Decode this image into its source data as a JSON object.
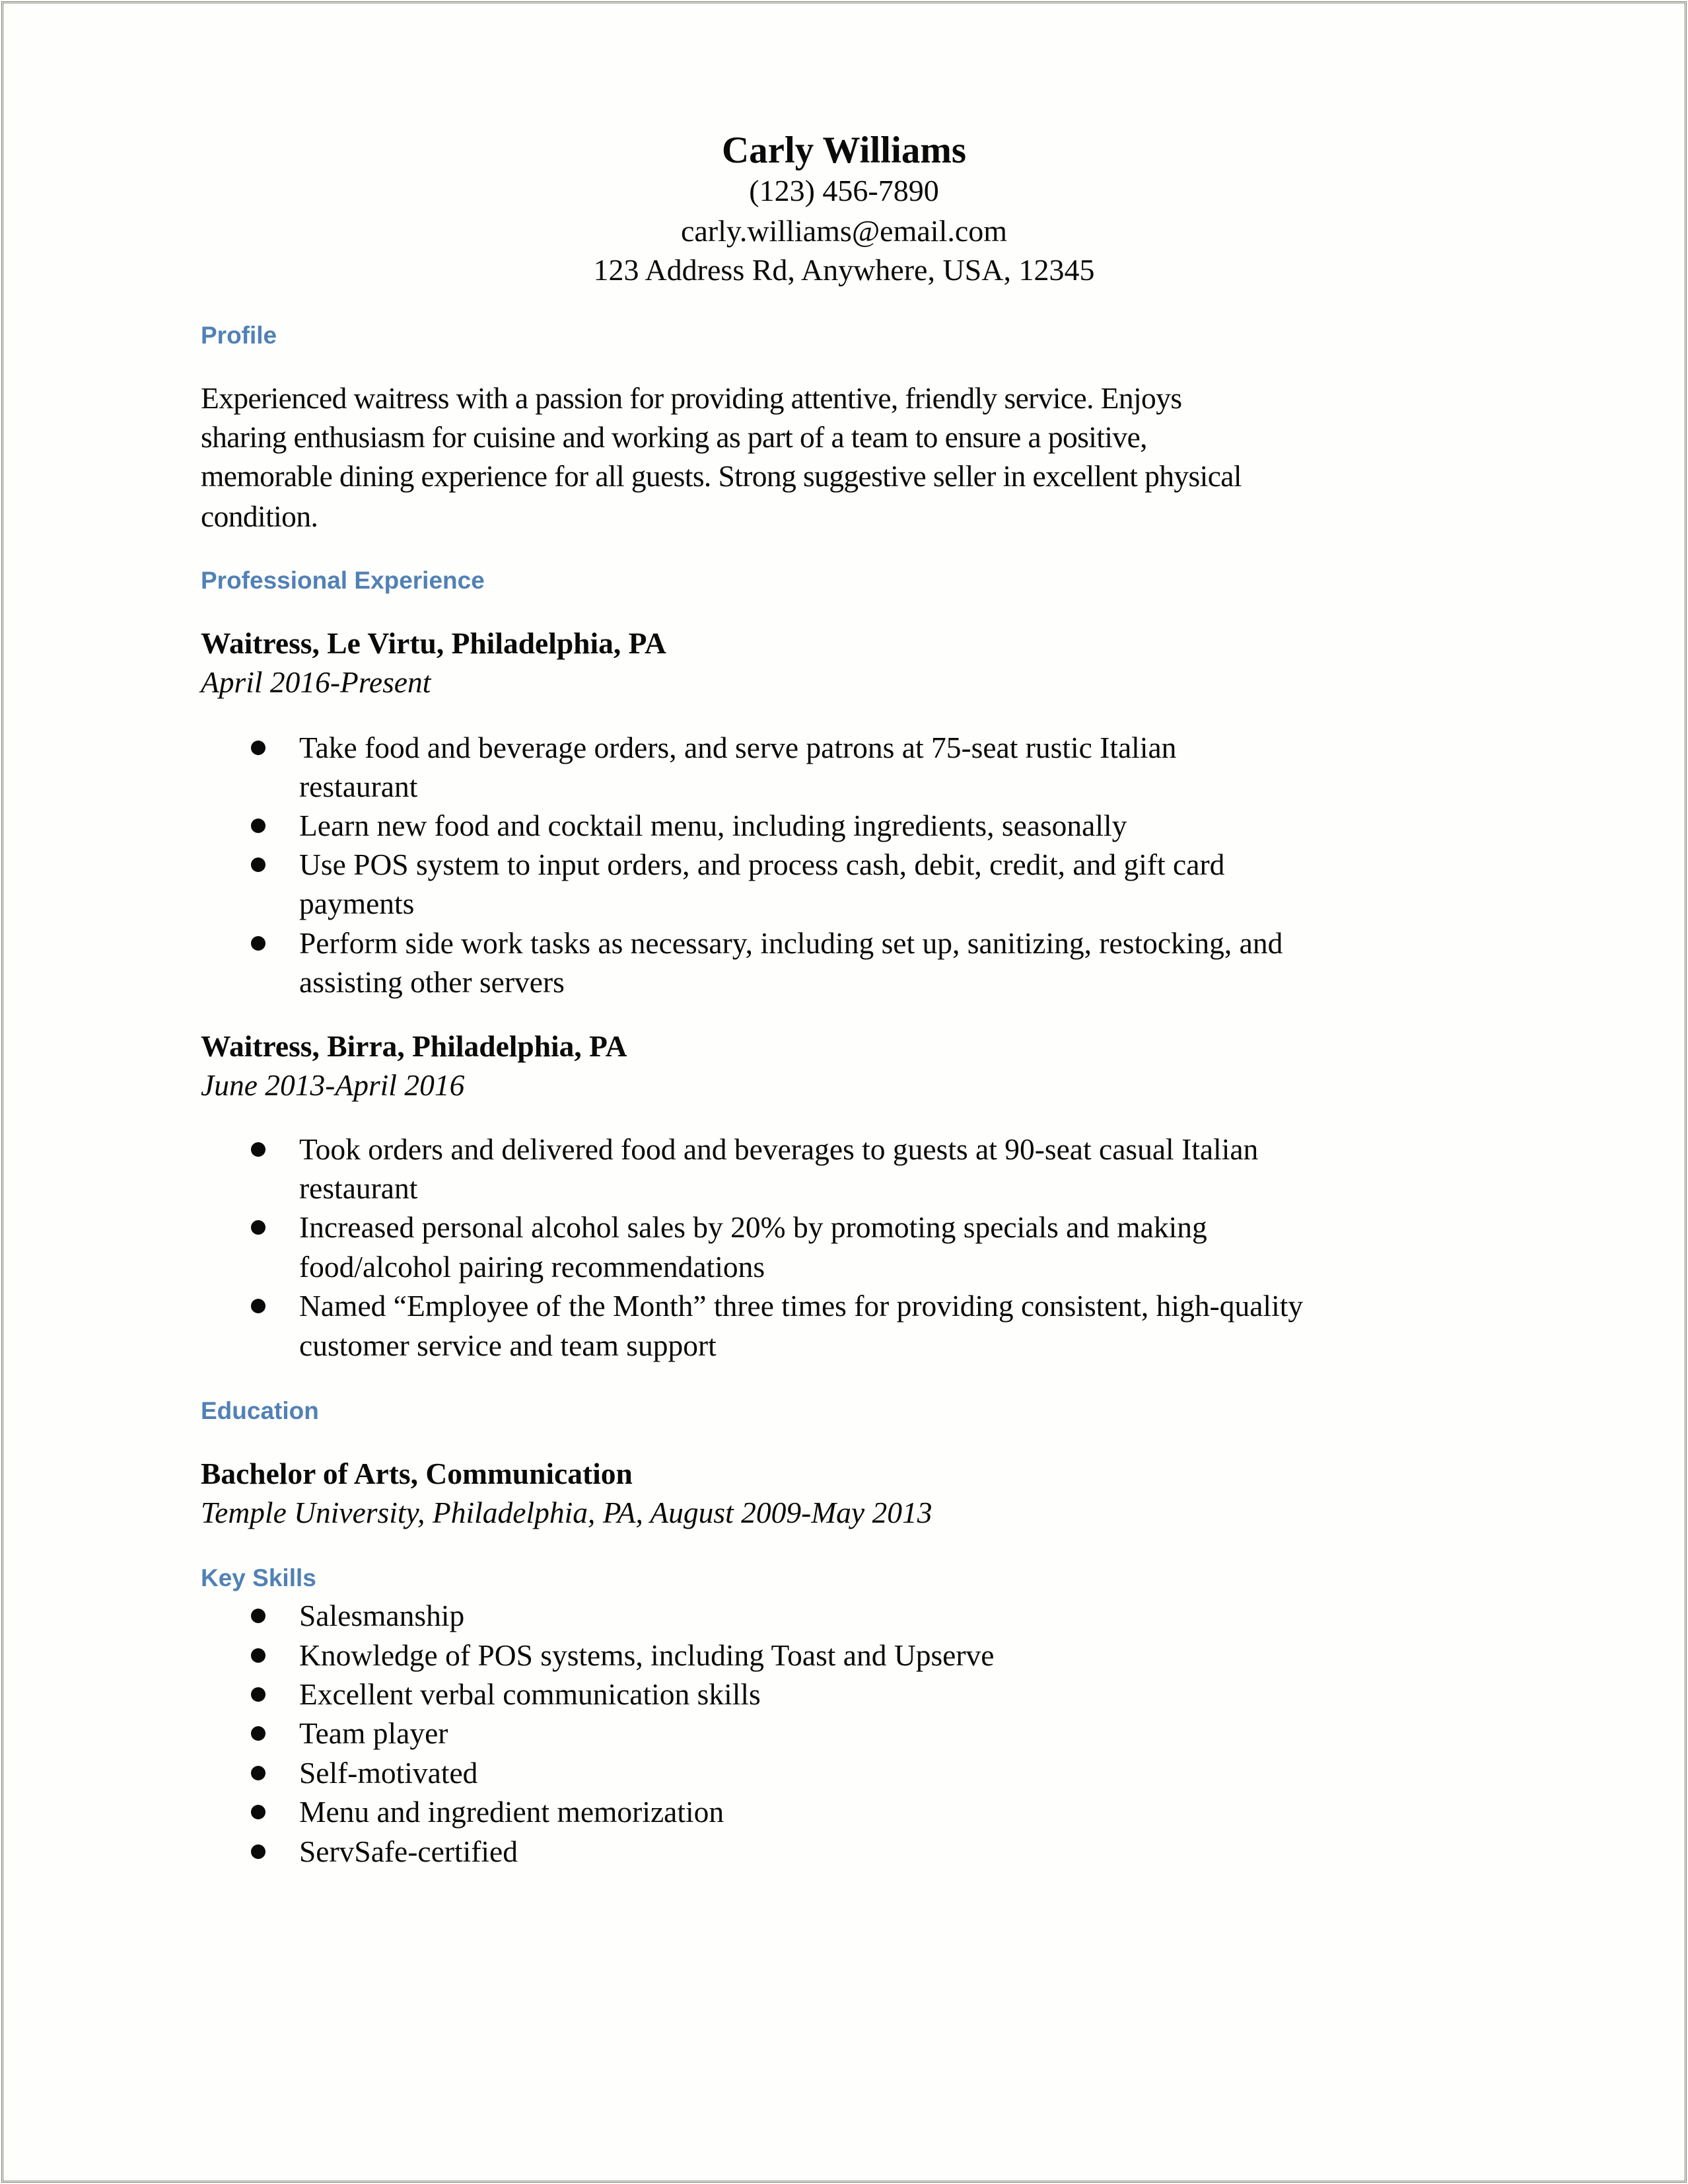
{
  "header": {
    "name": "Carly Williams",
    "phone": "(123) 456-7890",
    "email": "carly.williams@email.com",
    "address": "123 Address Rd, Anywhere, USA, 12345"
  },
  "profile": {
    "heading": "Profile",
    "lines": [
      "Experienced waitress with a passion for providing attentive, friendly service. Enjoys",
      "sharing enthusiasm for cuisine and working as part of a team to ensure a positive,",
      "memorable dining experience for all guests. Strong suggestive seller in excellent physical",
      "condition."
    ]
  },
  "experience": {
    "heading": "Professional Experience",
    "jobs": [
      {
        "title": "Waitress, Le Virtu, Philadelphia, PA",
        "dates": "April 2016-Present",
        "bullets": [
          [
            "Take food and beverage orders, and serve patrons at 75-seat rustic Italian",
            "restaurant"
          ],
          [
            "Learn new food and cocktail menu, including ingredients, seasonally"
          ],
          [
            "Use POS system to input orders, and process cash, debit, credit, and gift card",
            "payments"
          ],
          [
            "Perform side work tasks as necessary, including set up, sanitizing, restocking, and",
            "assisting other servers"
          ]
        ]
      },
      {
        "title": "Waitress, Birra, Philadelphia, PA",
        "dates": "June 2013-April 2016",
        "bullets": [
          [
            "Took orders and delivered food and beverages to guests at 90-seat casual Italian",
            "restaurant"
          ],
          [
            "Increased personal alcohol sales by 20% by promoting specials and making",
            "food/alcohol pairing recommendations"
          ],
          [
            "Named “Employee of the Month” three times for providing consistent, high-quality",
            "customer service and team support"
          ]
        ]
      }
    ]
  },
  "education": {
    "heading": "Education",
    "degree": "Bachelor of Arts, Communication",
    "school": "Temple University, Philadelphia, PA, August 2009-May 2013"
  },
  "skills": {
    "heading": "Key Skills",
    "items": [
      "Salesmanship",
      "Knowledge of POS systems, including Toast and Upserve",
      "Excellent verbal communication skills",
      "Team player",
      "Self-motivated",
      "Menu and ingredient memorization",
      "ServSafe-certified"
    ]
  },
  "colors": {
    "heading": "#5181b5",
    "text": "#0a0a0a",
    "border": "#7b8171"
  }
}
